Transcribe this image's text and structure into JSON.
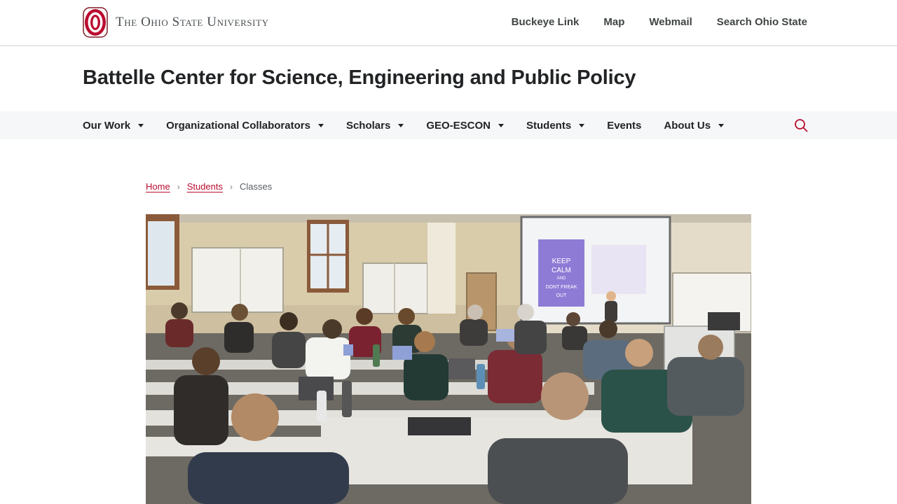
{
  "header": {
    "university_name": "The Ohio State University",
    "utility_links": [
      "Buckeye Link",
      "Map",
      "Webmail",
      "Search Ohio State"
    ]
  },
  "site": {
    "title": "Battelle Center for Science, Engineering and Public Policy"
  },
  "main_nav": {
    "items": [
      {
        "label": "Our Work",
        "has_dropdown": true
      },
      {
        "label": "Organizational Collaborators",
        "has_dropdown": true
      },
      {
        "label": "Scholars",
        "has_dropdown": true
      },
      {
        "label": "GEO-ESCON",
        "has_dropdown": true
      },
      {
        "label": "Students",
        "has_dropdown": true
      },
      {
        "label": "Events",
        "has_dropdown": false
      },
      {
        "label": "About Us",
        "has_dropdown": true
      }
    ],
    "search_icon": "search-icon"
  },
  "breadcrumb": {
    "home": "Home",
    "students": "Students",
    "current": "Classes"
  },
  "hero": {
    "screen_text": [
      "KEEP",
      "CALM",
      "AND",
      "DONT FREAK",
      "OUT"
    ]
  },
  "colors": {
    "accent": "#ba0c2f",
    "nav_bg": "#f6f7f8",
    "text": "#212325"
  }
}
